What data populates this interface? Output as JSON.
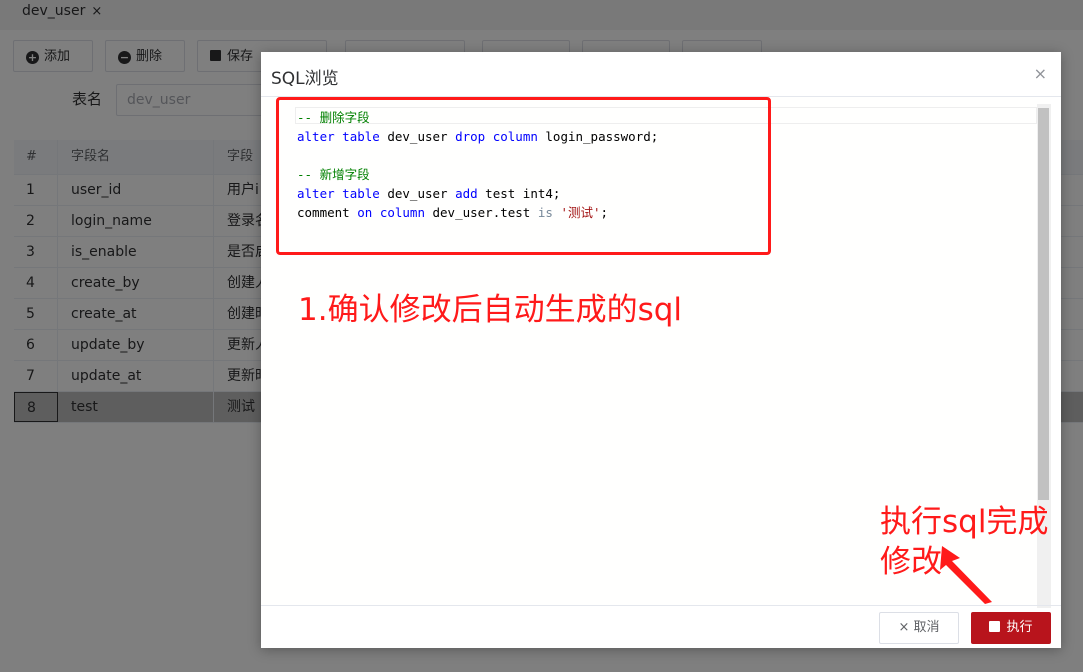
{
  "tab": {
    "title": "dev_user",
    "close": "×"
  },
  "toolbar": {
    "add_label": "添加",
    "delete_label": "删除",
    "save_label": "保存"
  },
  "table_name": {
    "label": "表名",
    "value": "dev_user"
  },
  "grid": {
    "headers": [
      "#",
      "字段名",
      "字段"
    ],
    "rows": [
      {
        "index": "1",
        "field": "user_id",
        "comment": "用户i"
      },
      {
        "index": "2",
        "field": "login_name",
        "comment": "登录名"
      },
      {
        "index": "3",
        "field": "is_enable",
        "comment": "是否启"
      },
      {
        "index": "4",
        "field": "create_by",
        "comment": "创建人"
      },
      {
        "index": "5",
        "field": "create_at",
        "comment": "创建时"
      },
      {
        "index": "6",
        "field": "update_by",
        "comment": "更新人"
      },
      {
        "index": "7",
        "field": "update_at",
        "comment": "更新时"
      },
      {
        "index": "8",
        "field": "test",
        "comment": "测试"
      }
    ]
  },
  "dialog": {
    "title": "SQL浏览",
    "close": "×",
    "sql": {
      "line1": "-- 删除字段",
      "line2_kw1": "alter",
      "line2_kw2": "table",
      "line2_t1": " dev_user ",
      "line2_kw3": "drop",
      "line2_kw4": "column",
      "line2_t2": " login_password;",
      "line4": "-- 新增字段",
      "line5_kw1": "alter",
      "line5_kw2": "table",
      "line5_t1": " dev_user ",
      "line5_kw3": "add",
      "line5_t2": " test int4;",
      "line6_t1": "comment ",
      "line6_kw1": "on",
      "line6_kw2": "column",
      "line6_t2": " dev_user.test ",
      "line6_op": "is",
      "line6_str": "'测试'",
      "line6_t3": ";"
    },
    "cancel_label": "取消",
    "execute_label": "执行"
  },
  "annotations": {
    "note1": "1.确认修改后自动生成的sql",
    "note2_line1": "执行sql完成",
    "note2_line2": "修改"
  },
  "colors": {
    "annotation": "#ff1a1a",
    "execute_button": "#b8141c"
  }
}
